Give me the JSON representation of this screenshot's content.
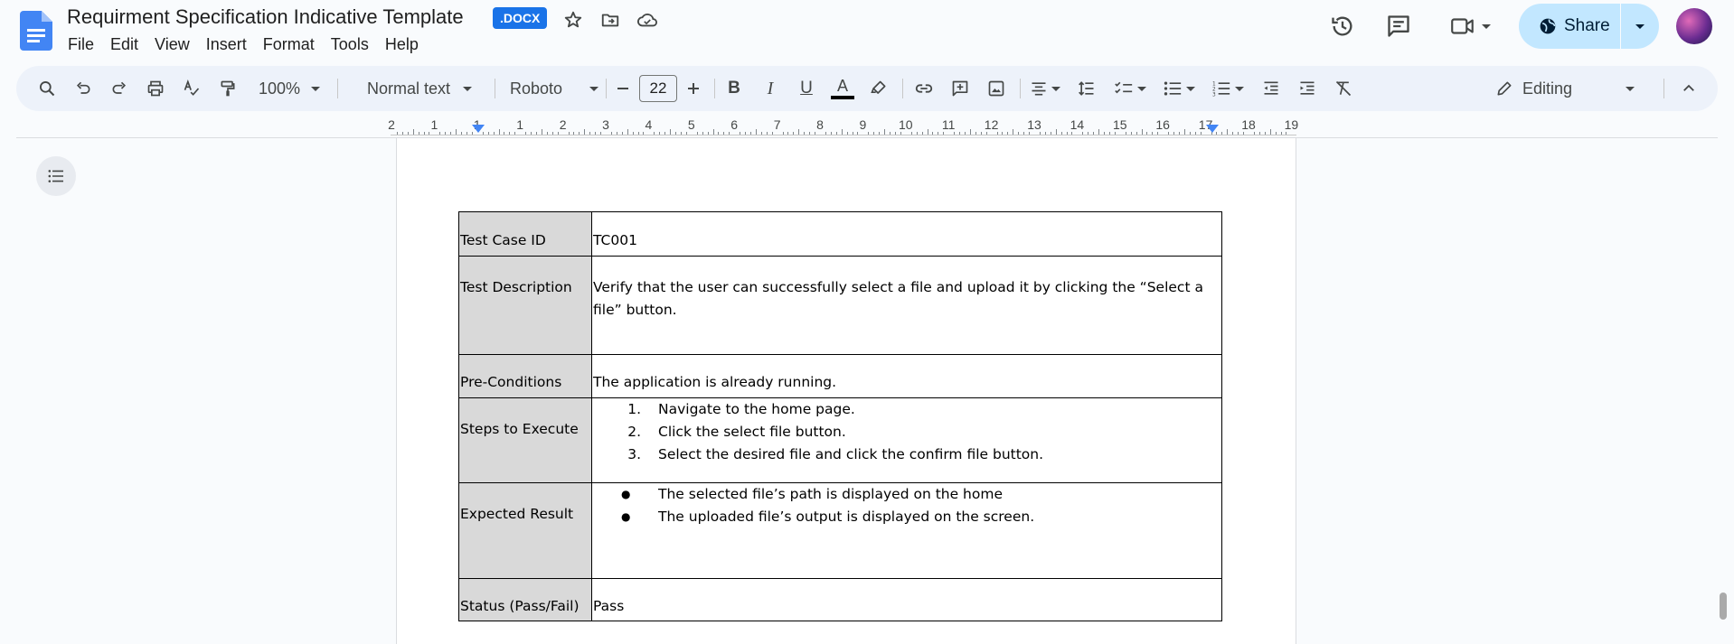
{
  "app": {
    "title": "Requirment Specification Indicative Template",
    "badge": ".DOCX",
    "menu": [
      "File",
      "Edit",
      "View",
      "Insert",
      "Format",
      "Tools",
      "Help"
    ],
    "share_label": "Share",
    "accent_color": "#1a73e8"
  },
  "toolbar": {
    "zoom": "100%",
    "style": "Normal text",
    "font": "Roboto",
    "font_size": "22",
    "mode": "Editing"
  },
  "ruler": {
    "numbers": [
      "2",
      "1",
      "1",
      "1",
      "2",
      "3",
      "4",
      "5",
      "6",
      "7",
      "8",
      "9",
      "10",
      "11",
      "12",
      "13",
      "14",
      "15",
      "16",
      "17",
      "18",
      "19"
    ]
  },
  "test_case": {
    "rows": [
      {
        "label": "Test Case ID",
        "value": "TC001"
      },
      {
        "label": "Test Description",
        "value": "Verify that the user can successfully select a file and upload it by clicking the “Select a file” button."
      },
      {
        "label": "Pre-Conditions",
        "value": "The application is already running."
      },
      {
        "label": "Steps to Execute",
        "steps": [
          "Navigate to the home page.",
          "Click the select file button.",
          "Select the desired file and click the confirm file button."
        ]
      },
      {
        "label": "Expected Result",
        "bullets": [
          "The selected file’s path is displayed on the home",
          "The uploaded file’s output is displayed on the screen."
        ]
      },
      {
        "label": "Status (Pass/Fail)",
        "value": "Pass"
      }
    ]
  }
}
